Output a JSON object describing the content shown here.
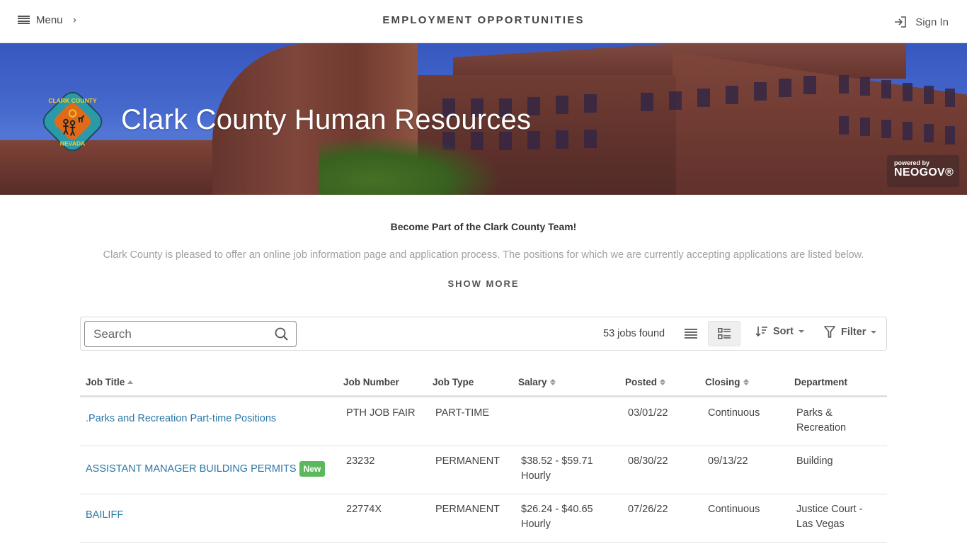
{
  "nav": {
    "menu_label": "Menu",
    "title": "EMPLOYMENT OPPORTUNITIES",
    "sign_in_label": "Sign In"
  },
  "banner": {
    "org_title": "Clark County Human Resources",
    "logo_text_top": "CLARK COUNTY",
    "logo_text_bottom": "NEVADA",
    "powered_by": "powered by",
    "vendor": "NEOGOV®"
  },
  "intro": {
    "heading": "Become Part of the Clark County Team!",
    "text": "Clark County is pleased to offer an online job information page and application process. The positions for which we are currently accepting applications are listed below.",
    "show_more": "SHOW MORE"
  },
  "toolbar": {
    "search_placeholder": "Search",
    "jobs_found": "53 jobs found",
    "sort_label": "Sort",
    "filter_label": "Filter",
    "active_view": "card"
  },
  "table": {
    "columns": [
      {
        "label": "Job Title",
        "sort": "asc"
      },
      {
        "label": "Job Number",
        "sort": "none"
      },
      {
        "label": "Job Type",
        "sort": "none"
      },
      {
        "label": "Salary",
        "sort": "sortable"
      },
      {
        "label": "Posted",
        "sort": "sortable"
      },
      {
        "label": "Closing",
        "sort": "sortable"
      },
      {
        "label": "Department",
        "sort": "none"
      }
    ],
    "rows": [
      {
        "title": ".Parks and Recreation Part-time Positions",
        "badge": "",
        "job_number": "PTH JOB FAIR",
        "job_type": "PART-TIME",
        "salary_line1": "",
        "salary_line2": "",
        "posted": "03/01/22",
        "closing": "Continuous",
        "dept_line1": "Parks &",
        "dept_line2": "Recreation"
      },
      {
        "title": "ASSISTANT MANAGER BUILDING PERMITS",
        "badge": "New",
        "job_number": "23232",
        "job_type": "PERMANENT",
        "salary_line1": "$38.52 - $59.71",
        "salary_line2": "Hourly",
        "posted": "08/30/22",
        "closing": "09/13/22",
        "dept_line1": "Building",
        "dept_line2": ""
      },
      {
        "title": "BAILIFF",
        "badge": "",
        "job_number": "22774X",
        "job_type": "PERMANENT",
        "salary_line1": "$26.24 - $40.65",
        "salary_line2": "Hourly",
        "posted": "07/26/22",
        "closing": "Continuous",
        "dept_line1": "Justice Court -",
        "dept_line2": "Las Vegas"
      }
    ]
  },
  "colors": {
    "link": "#2a77a6",
    "badge_new": "#5cb85c",
    "text": "#444444",
    "muted_text": "#a0a0a0"
  }
}
